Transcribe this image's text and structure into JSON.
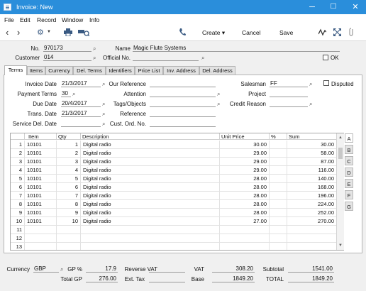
{
  "window": {
    "title": "Invoice: New",
    "minimize": "─",
    "maximize": "☐",
    "close": "✕"
  },
  "menu": [
    "File",
    "Edit",
    "Record",
    "Window",
    "Info"
  ],
  "toolbar": {
    "create": "Create ▾",
    "cancel": "Cancel",
    "save": "Save",
    "prev": "‹",
    "next": "›"
  },
  "header": {
    "no_label": "No.",
    "no_value": "970173",
    "name_label": "Name",
    "name_value": "Magic Flute Systems",
    "customer_label": "Customer",
    "customer_value": "014",
    "official_label": "Official No.",
    "official_value": "",
    "ok_label": "OK"
  },
  "tabs": [
    "Terms",
    "Items",
    "Currency",
    "Del. Terms",
    "Identifiers",
    "Price List",
    "Inv. Address",
    "Del. Address"
  ],
  "terms": {
    "invoice_date_label": "Invoice Date",
    "invoice_date": "21/3/2017",
    "our_ref_label": "Our Reference",
    "our_ref": "",
    "salesman_label": "Salesman",
    "salesman": "FF",
    "disputed_label": "Disputed",
    "payment_terms_label": "Payment Terms",
    "payment_terms": "30",
    "attention_label": "Attention",
    "attention": "",
    "project_label": "Project",
    "project": "",
    "due_date_label": "Due Date",
    "due_date": "20/4/2017",
    "tags_label": "Tags/Objects",
    "tags": "",
    "credit_reason_label": "Credit Reason",
    "credit_reason": "",
    "trans_date_label": "Trans. Date",
    "trans_date": "21/3/2017",
    "reference_label": "Reference",
    "reference": "",
    "service_del_label": "Service Del. Date",
    "service_del": "",
    "cust_ord_label": "Cust. Ord. No.",
    "cust_ord": ""
  },
  "grid": {
    "headers": [
      "Item",
      "Qty",
      "Description",
      "Unit Price",
      "%",
      "Sum"
    ],
    "rows": [
      {
        "n": "1",
        "item": "10101",
        "qty": "1",
        "desc": "Digital radio",
        "price": "30.00",
        "pct": "",
        "sum": "30.00"
      },
      {
        "n": "2",
        "item": "10101",
        "qty": "2",
        "desc": "Digital radio",
        "price": "29.00",
        "pct": "",
        "sum": "58.00"
      },
      {
        "n": "3",
        "item": "10101",
        "qty": "3",
        "desc": "Digital radio",
        "price": "29.00",
        "pct": "",
        "sum": "87.00"
      },
      {
        "n": "4",
        "item": "10101",
        "qty": "4",
        "desc": "Digital radio",
        "price": "29.00",
        "pct": "",
        "sum": "116.00"
      },
      {
        "n": "5",
        "item": "10101",
        "qty": "5",
        "desc": "Digital radio",
        "price": "28.00",
        "pct": "",
        "sum": "140.00"
      },
      {
        "n": "6",
        "item": "10101",
        "qty": "6",
        "desc": "Digital radio",
        "price": "28.00",
        "pct": "",
        "sum": "168.00"
      },
      {
        "n": "7",
        "item": "10101",
        "qty": "7",
        "desc": "Digital radio",
        "price": "28.00",
        "pct": "",
        "sum": "196.00"
      },
      {
        "n": "8",
        "item": "10101",
        "qty": "8",
        "desc": "Digital radio",
        "price": "28.00",
        "pct": "",
        "sum": "224.00"
      },
      {
        "n": "9",
        "item": "10101",
        "qty": "9",
        "desc": "Digital radio",
        "price": "28.00",
        "pct": "",
        "sum": "252.00"
      },
      {
        "n": "10",
        "item": "10101",
        "qty": "10",
        "desc": "Digital radio",
        "price": "27.00",
        "pct": "",
        "sum": "270.00"
      },
      {
        "n": "11",
        "item": "",
        "qty": "",
        "desc": "",
        "price": "",
        "pct": "",
        "sum": ""
      },
      {
        "n": "12",
        "item": "",
        "qty": "",
        "desc": "",
        "price": "",
        "pct": "",
        "sum": ""
      },
      {
        "n": "13",
        "item": "",
        "qty": "",
        "desc": "",
        "price": "",
        "pct": "",
        "sum": ""
      }
    ],
    "side_tabs": [
      "A",
      "B",
      "C",
      "D",
      "E",
      "F",
      "G"
    ]
  },
  "footer": {
    "currency_label": "Currency",
    "currency": "GBP",
    "gp_pct_label": "GP %",
    "gp_pct": "17.9",
    "reverse_vat_label": "Reverse VAT",
    "reverse_vat": "",
    "vat_label": "VAT",
    "vat": "308.20",
    "subtotal_label": "Subtotal",
    "subtotal": "1541.00",
    "total_gp_label": "Total GP",
    "total_gp": "276.00",
    "ext_tax_label": "Ext. Tax",
    "ext_tax": "",
    "base_label": "Base",
    "base": "1849.20",
    "total_label": "TOTAL",
    "total": "1849.20"
  },
  "colors": {
    "titlebar": "#2a8edb",
    "accent_icon": "#3a5a82"
  }
}
